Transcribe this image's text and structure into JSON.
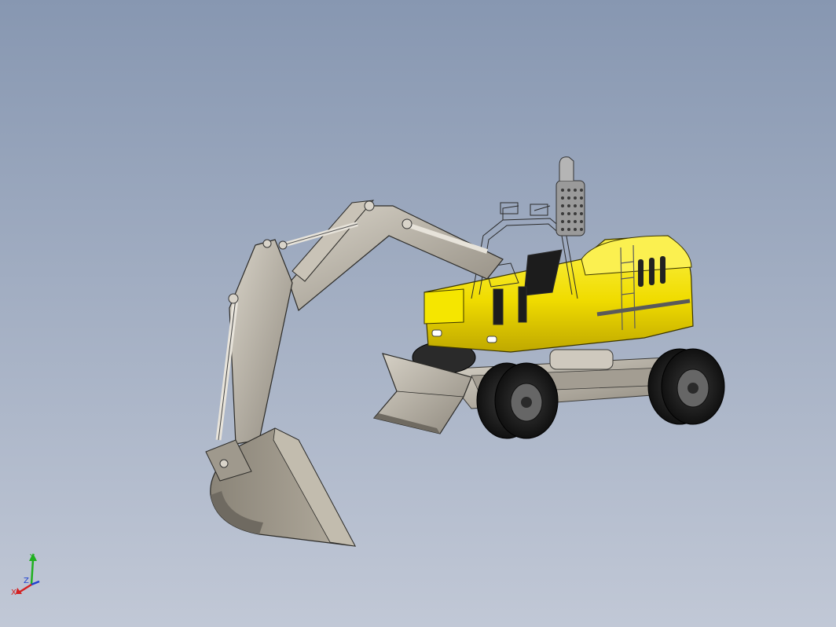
{
  "viewport": {
    "background_top": "#8797b1",
    "background_bottom": "#c1c8d6"
  },
  "model": {
    "body_color": "#f2e000",
    "steel_color": "#b9b3a8",
    "tire_color": "#1c1c1c"
  },
  "triad": {
    "x_label": "X",
    "y_label": "Y",
    "z_label": "Z",
    "x_color": "#d42020",
    "y_color": "#20b020",
    "z_color": "#2040d0"
  }
}
